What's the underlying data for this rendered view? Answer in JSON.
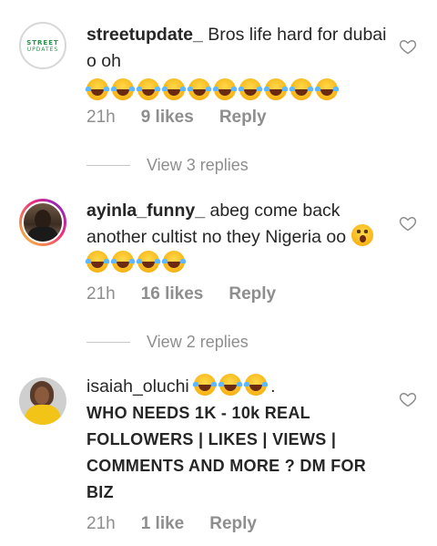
{
  "comments": [
    {
      "username": "streetupdate_",
      "text": "Bros life hard for dubai o oh",
      "emoji_count": 10,
      "avatar_label": [
        "STREET",
        "UPDATES"
      ],
      "time": "21h",
      "likes": "9 likes",
      "reply": "Reply",
      "view_replies": "View 3 replies"
    },
    {
      "username": "ayinla_funny_",
      "text": "abeg come back another cultist no they Nigeria oo",
      "time": "21h",
      "likes": "16 likes",
      "reply": "Reply",
      "view_replies": "View 2 replies"
    },
    {
      "username": "isaiah_oluchi",
      "dot": ".",
      "promo_text": "WHO NEEDS 1K - 10k REAL FOLLOWERS | LIKES | VIEWS | COMMENTS AND MORE ? DM FOR BIZ",
      "time": "21h",
      "likes": "1 like",
      "reply": "Reply"
    }
  ],
  "icons": {
    "like": "heart-outline-icon",
    "laugh_emoji": "face-with-tears-of-joy",
    "wow_emoji": "face-with-open-mouth"
  },
  "colors": {
    "text": "#262626",
    "meta": "#8e8e8e",
    "divider": "#c7c7c7"
  }
}
